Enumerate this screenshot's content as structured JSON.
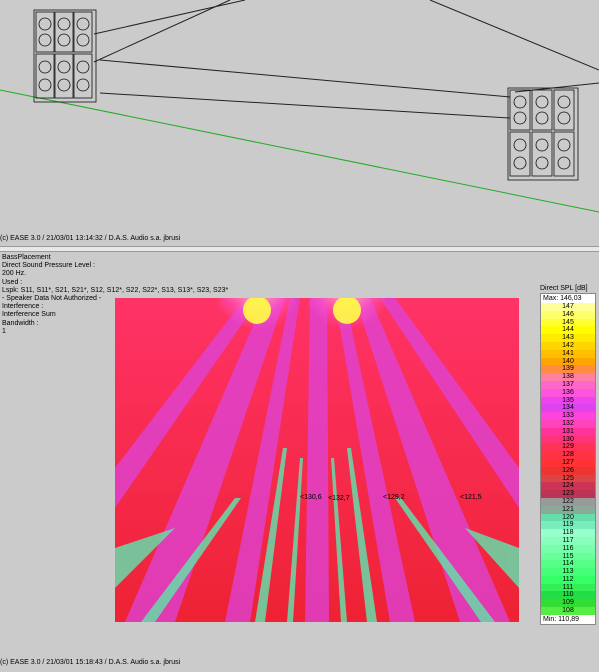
{
  "top_view": {
    "footer": "(c) EASE 3.0 / 21/03/01 13:14:32 / D.A.S. Audio s.a. jbrusi"
  },
  "bottom_view": {
    "info_lines": [
      "BassPlacement",
      "Direct Sound Pressure Level :",
      "200 Hz.",
      "Used :",
      "Lspk: S11, S11*, S21, S21*, S12, S12*, S22, S22*, S13, S13*, S23, S23*",
      "- Speaker Data Not Authorized -",
      "Interference :",
      "Interference Sum",
      "Bandwidth :",
      "1"
    ],
    "probes": [
      "<130,6",
      "<132,7",
      "<129,2",
      "<121,5"
    ],
    "footer": "(c) EASE 3.0 / 21/03/01 15:18:43 / D.A.S. Audio s.a. jbrusi"
  },
  "legend": {
    "title": "Direct SPL [dB]",
    "max_label": "Max: 146,03",
    "min_label": "Min: 110,89",
    "levels": [
      {
        "value": "147",
        "color": "#ffff99"
      },
      {
        "value": "146",
        "color": "#ffff66"
      },
      {
        "value": "145",
        "color": "#ffff33"
      },
      {
        "value": "144",
        "color": "#ffff00"
      },
      {
        "value": "143",
        "color": "#ffea00"
      },
      {
        "value": "142",
        "color": "#ffd500"
      },
      {
        "value": "141",
        "color": "#ffbf00"
      },
      {
        "value": "140",
        "color": "#ffa500"
      },
      {
        "value": "139",
        "color": "#ff8c40"
      },
      {
        "value": "138",
        "color": "#ff80a0"
      },
      {
        "value": "137",
        "color": "#ff66cc"
      },
      {
        "value": "136",
        "color": "#ff55dd"
      },
      {
        "value": "135",
        "color": "#ee44ee"
      },
      {
        "value": "134",
        "color": "#dd44ee"
      },
      {
        "value": "133",
        "color": "#ff44dd"
      },
      {
        "value": "132",
        "color": "#ff44bb"
      },
      {
        "value": "131",
        "color": "#ff3399"
      },
      {
        "value": "130",
        "color": "#ff3377"
      },
      {
        "value": "129",
        "color": "#ff3355"
      },
      {
        "value": "128",
        "color": "#ff3344"
      },
      {
        "value": "127",
        "color": "#ff3333"
      },
      {
        "value": "126",
        "color": "#ee3333"
      },
      {
        "value": "125",
        "color": "#dd4444"
      },
      {
        "value": "124",
        "color": "#cc3355"
      },
      {
        "value": "123",
        "color": "#bb3355"
      },
      {
        "value": "122",
        "color": "#999999"
      },
      {
        "value": "121",
        "color": "#88aa99"
      },
      {
        "value": "120",
        "color": "#66ddaa"
      },
      {
        "value": "119",
        "color": "#77eebb"
      },
      {
        "value": "118",
        "color": "#99ffcc"
      },
      {
        "value": "117",
        "color": "#88ffbb"
      },
      {
        "value": "116",
        "color": "#77ffaa"
      },
      {
        "value": "115",
        "color": "#66ff99"
      },
      {
        "value": "114",
        "color": "#55ff88"
      },
      {
        "value": "113",
        "color": "#44ff77"
      },
      {
        "value": "112",
        "color": "#33ff66"
      },
      {
        "value": "111",
        "color": "#33ee55"
      },
      {
        "value": "110",
        "color": "#22dd44"
      },
      {
        "value": "109",
        "color": "#33dd33"
      },
      {
        "value": "108",
        "color": "#55ee44"
      }
    ]
  }
}
